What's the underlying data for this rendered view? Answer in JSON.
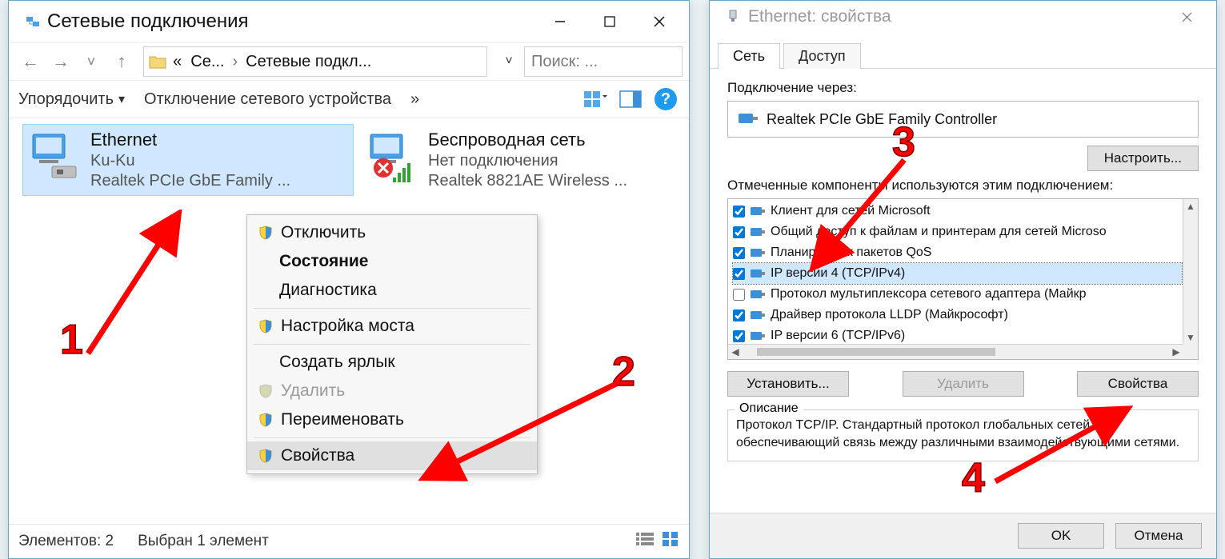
{
  "left_window": {
    "title": "Сетевые подключения",
    "nav": {
      "breadcrumb_prefix": "«",
      "crumb1": "Се...",
      "crumb2": "Сетевые подкл...",
      "search_placeholder": "Поиск: ..."
    },
    "cmdbar": {
      "organize": "Упорядочить",
      "disable_device": "Отключение сетевого устройства"
    },
    "connections": {
      "ethernet": {
        "name": "Ethernet",
        "status": "Ku-Ku",
        "device": "Realtek PCIe GbE Family ..."
      },
      "wireless": {
        "name": "Беспроводная сеть",
        "status": "Нет подключения",
        "device": "Realtek 8821AE Wireless ..."
      }
    },
    "context_menu": {
      "disable": "Отключить",
      "status": "Состояние",
      "diagnose": "Диагностика",
      "bridge": "Настройка моста",
      "shortcut": "Создать ярлык",
      "delete": "Удалить",
      "rename": "Переименовать",
      "properties": "Свойства"
    },
    "statusbar": {
      "elements": "Элементов: 2",
      "selected": "Выбран 1 элемент"
    }
  },
  "right_window": {
    "title": "Ethernet: свойства",
    "tabs": {
      "network": "Сеть",
      "access": "Доступ"
    },
    "connect_via_label": "Подключение через:",
    "adapter": "Realtek PCIe GbE Family Controller",
    "configure_btn": "Настроить...",
    "components_label": "Отмеченные компоненты используются этим подключением:",
    "components": [
      {
        "checked": true,
        "label": "Клиент для сетей Microsoft"
      },
      {
        "checked": true,
        "label": "Общий доступ к файлам и принтерам для сетей Microso"
      },
      {
        "checked": true,
        "label": "Планировщик пакетов QoS"
      },
      {
        "checked": true,
        "label": "IP версии 4 (TCP/IPv4)",
        "selected": true
      },
      {
        "checked": false,
        "label": "Протокол мультиплексора сетевого адаптера (Майкр"
      },
      {
        "checked": true,
        "label": "Драйвер протокола LLDP (Майкрософт)"
      },
      {
        "checked": true,
        "label": "IP версии 6 (TCP/IPv6)"
      }
    ],
    "install_btn": "Установить...",
    "remove_btn": "Удалить",
    "properties_btn": "Свойства",
    "desc_legend": "Описание",
    "desc_text": "Протокол TCP/IP. Стандартный протокол глобальных сетей, обеспечивающий связь между различными взаимодействующими сетями.",
    "ok_btn": "OK",
    "cancel_btn": "Отмена"
  },
  "annotations": {
    "n1": "1",
    "n2": "2",
    "n3": "3",
    "n4": "4"
  }
}
